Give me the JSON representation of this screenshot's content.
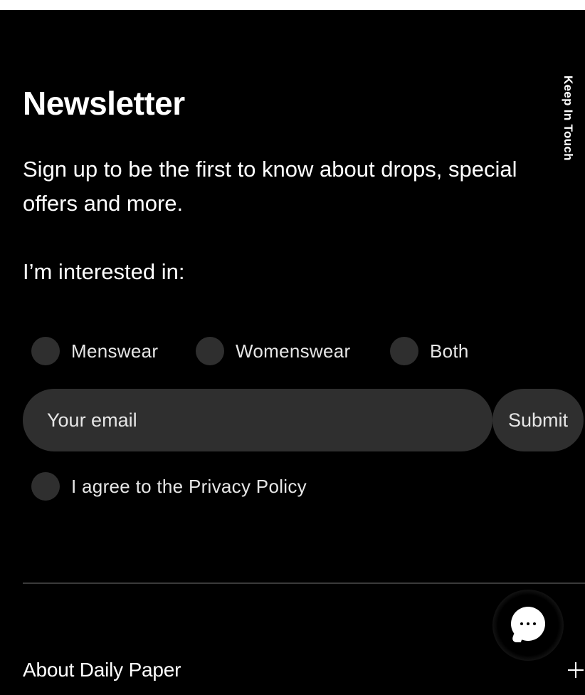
{
  "side_tab": {
    "label": "Keep In Touch"
  },
  "newsletter": {
    "title": "Newsletter",
    "intro": "Sign up to be the first to know about drops, special offers and more.",
    "interest_label": "I’m interested in:",
    "options": [
      {
        "label": "Menswear",
        "selected": false
      },
      {
        "label": "Womenswear",
        "selected": false
      },
      {
        "label": "Both",
        "selected": false
      }
    ],
    "email": {
      "placeholder": "Your email",
      "value": ""
    },
    "submit_label": "Submit",
    "privacy_label": "I agree to the Privacy Policy",
    "privacy_checked": false
  },
  "footer": {
    "about_label": "About Daily Paper"
  },
  "colors": {
    "background": "#000000",
    "control": "#2f2f2f",
    "text": "#ffffff",
    "divider": "#3a3a3a"
  },
  "icons": {
    "chat": "chat-bubble-icon",
    "expand": "plus-icon"
  }
}
